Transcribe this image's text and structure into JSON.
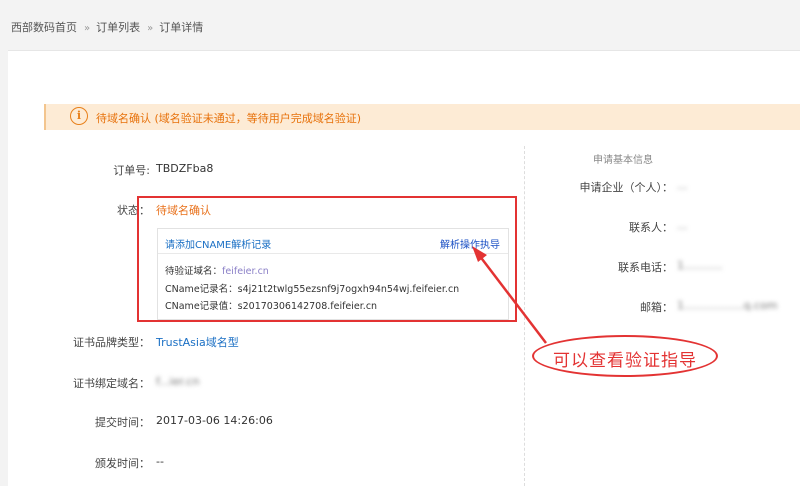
{
  "breadcrumb": {
    "items": [
      "西部数码首页",
      "订单列表",
      "订单详情"
    ],
    "separator": "»"
  },
  "alert": {
    "icon": "info-icon",
    "icon_glyph": "i",
    "text": "待域名确认 (域名验证未通过，等待用户完成域名验证)"
  },
  "order": {
    "number_label": "订单号:",
    "number_value": "TBDZFba8",
    "status_label": "状态：",
    "status_value": "待域名确认",
    "brand_label": "证书品牌类型：",
    "brand_value": "TrustAsia域名型",
    "domain_label": "证书绑定域名：",
    "domain_value": "f...ier.cn",
    "submit_label": "提交时间：",
    "submit_value": "2017-03-06 14:26:06",
    "issue_label": "颁发时间：",
    "issue_value": "--"
  },
  "cname": {
    "title": "请添加CNAME解析记录",
    "guide_link": "解析操作执导",
    "verify_domain_label": "待验证域名：",
    "verify_domain_value": "feifeier.cn",
    "record_name_label": "CName记录名：",
    "record_name_value": "s4j21t2twlg55ezsnf9j7ogxh94n54wj.feifeier.cn",
    "record_value_label": "CName记录值：",
    "record_value_value": "s20170306142708.feifeier.cn"
  },
  "applicant": {
    "heading": "申请基本信息",
    "company_label": "申请企业（个人）：",
    "company_value": "...",
    "contact_label": "联系人：",
    "contact_value": "...",
    "phone_label": "联系电话：",
    "phone_value": "1...........",
    "email_label": "邮箱：",
    "email_value": "1.................q.com"
  },
  "annotation": {
    "callout_text": "可以查看验证指导"
  },
  "colors": {
    "accent_orange": "#e8701a",
    "link_blue": "#1a6fc4",
    "annotation_red": "#e33333",
    "alert_bg": "#fdebd5"
  }
}
